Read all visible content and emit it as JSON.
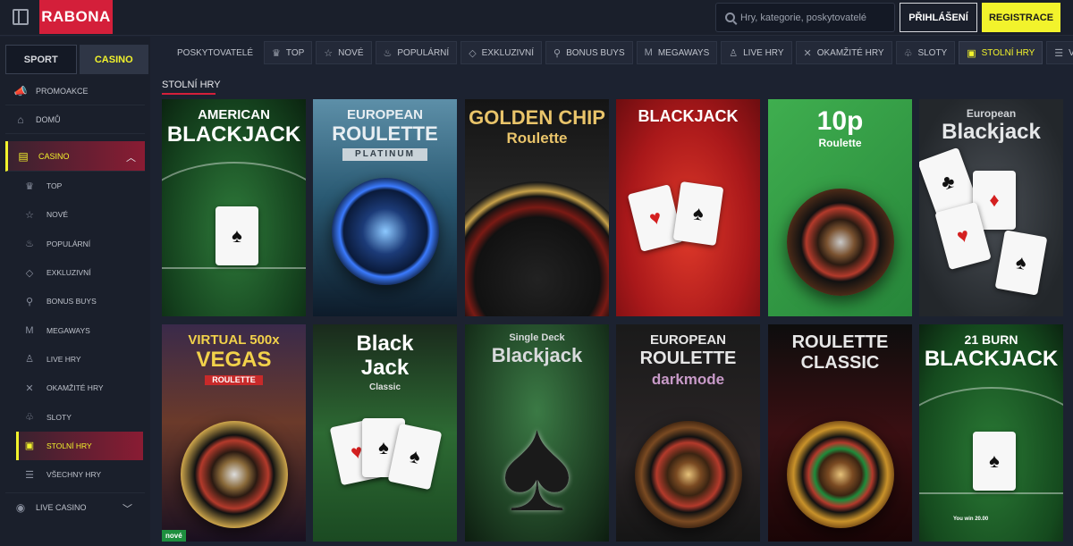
{
  "header": {
    "logo": "RABONA",
    "search_placeholder": "Hry, kategorie, poskytovatelé",
    "login_label": "PŘIHLÁŠENÍ",
    "register_label": "REGISTRACE"
  },
  "sidebar": {
    "switch": {
      "sport": "SPORT",
      "casino": "CASINO"
    },
    "top_items": [
      {
        "label": "PROMOAKCE",
        "icon": "megaphone-icon"
      },
      {
        "label": "DOMŮ",
        "icon": "home-icon"
      }
    ],
    "casino": {
      "label": "CASINO",
      "icon": "cards-icon"
    },
    "sub_items": [
      {
        "label": "TOP",
        "icon": "crown-icon"
      },
      {
        "label": "NOVÉ",
        "icon": "star-icon"
      },
      {
        "label": "POPULÁRNÍ",
        "icon": "flame-icon"
      },
      {
        "label": "EXKLUZIVNÍ",
        "icon": "diamond-icon"
      },
      {
        "label": "BONUS BUYS",
        "icon": "bag-icon"
      },
      {
        "label": "MEGAWAYS",
        "icon": "m-icon"
      },
      {
        "label": "LIVE HRY",
        "icon": "person-icon"
      },
      {
        "label": "OKAMŽITÉ HRY",
        "icon": "bolt-icon"
      },
      {
        "label": "SLOTY",
        "icon": "cherry-icon"
      },
      {
        "label": "STOLNÍ HRY",
        "icon": "table-icon",
        "active": true
      },
      {
        "label": "VŠECHNY HRY",
        "icon": "grid-icon"
      }
    ],
    "live_casino": {
      "label": "LIVE CASINO",
      "icon": "live-icon"
    }
  },
  "tabs": [
    {
      "label": "POSKYTOVATELÉ",
      "icon": ""
    },
    {
      "label": "TOP",
      "icon": "crown-icon"
    },
    {
      "label": "NOVÉ",
      "icon": "star-icon"
    },
    {
      "label": "POPULÁRNÍ",
      "icon": "flame-icon"
    },
    {
      "label": "EXKLUZIVNÍ",
      "icon": "diamond-icon"
    },
    {
      "label": "BONUS BUYS",
      "icon": "bag-icon"
    },
    {
      "label": "MEGAWAYS",
      "icon": "m-icon"
    },
    {
      "label": "LIVE HRY",
      "icon": "person-icon"
    },
    {
      "label": "OKAMŽITÉ HRY",
      "icon": "bolt-icon"
    },
    {
      "label": "SLOTY",
      "icon": "cherry-icon"
    },
    {
      "label": "STOLNÍ HRY",
      "icon": "table-icon",
      "active": true
    },
    {
      "label": "VŠECHNY HRY",
      "icon": "grid-icon"
    }
  ],
  "section_title": "STOLNÍ HRY",
  "games": [
    {
      "line1": "AMERICAN",
      "line2": "BLACKJACK",
      "sub": "",
      "theme": "green-table"
    },
    {
      "line1": "EUROPEAN",
      "line2": "ROULETTE",
      "sub": "PLATINUM",
      "theme": "blue-wheel"
    },
    {
      "line1": "GOLDEN CHIP",
      "line2": "Roulette",
      "sub": "GOLDEN CHIP Roulette",
      "theme": "gold-wheel"
    },
    {
      "line1": "BLACKJACK",
      "line2": "",
      "sub": "",
      "theme": "red-cards"
    },
    {
      "line1": "10p",
      "line2": "Roulette",
      "sub": "",
      "theme": "green-wheel"
    },
    {
      "line1": "European",
      "line2": "Blackjack",
      "sub": "",
      "theme": "grey-cards"
    },
    {
      "line1": "VIRTUAL 500x",
      "line2": "VEGAS",
      "sub": "ROULETTE",
      "theme": "vegas",
      "badge": "nové"
    },
    {
      "line1": "Black",
      "line2": "Jack",
      "sub": "Classic",
      "theme": "green-cards"
    },
    {
      "line1": "Single Deck",
      "line2": "Blackjack",
      "sub": "",
      "theme": "spade"
    },
    {
      "line1": "EUROPEAN",
      "line2": "ROULETTE",
      "sub": "darkmode",
      "theme": "dark-wheel"
    },
    {
      "line1": "ROULETTE",
      "line2": "CLASSIC",
      "sub": "",
      "theme": "red-wheel"
    },
    {
      "line1": "21 BURN",
      "line2": "BLACKJACK",
      "sub": "You win 20.00",
      "theme": "green-table2"
    }
  ],
  "colors": {
    "accent_yellow": "#f2f32c",
    "brand_red": "#d41f3a",
    "background": "#1c2230"
  }
}
